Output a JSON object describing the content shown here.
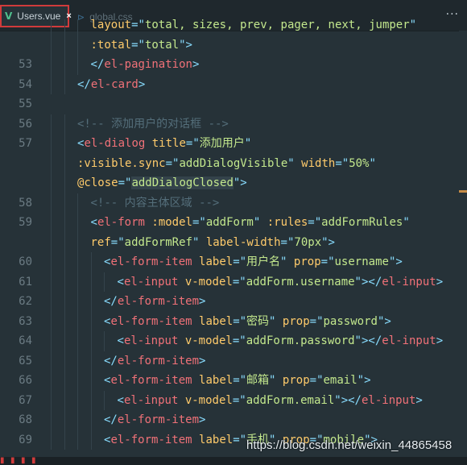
{
  "tabs": [
    {
      "name": "Users.vue",
      "icon": "vue-icon",
      "icon_glyph": "V",
      "close": "×",
      "active": true
    },
    {
      "name": "global.css",
      "icon": "css-icon",
      "icon_glyph": "⊳",
      "active": false
    }
  ],
  "tab_menu_label": "···",
  "colors": {
    "tag": "#f07178",
    "punctuation": "#89ddff",
    "attribute": "#ffcb6b",
    "string": "#c3e88d",
    "comment": "#546e7a",
    "background": "#263238",
    "active_tab_border": "#d03b3b"
  },
  "lines": [
    {
      "num": "",
      "indent": 3,
      "tokens": [
        [
          "a",
          "layout"
        ],
        [
          "p",
          "=\""
        ],
        [
          "s",
          "total, sizes, prev, pager, next, jumper"
        ],
        [
          "p",
          "\""
        ]
      ]
    },
    {
      "num": "",
      "indent": 3,
      "tokens": [
        [
          "a",
          ":total"
        ],
        [
          "p",
          "=\""
        ],
        [
          "s",
          "total"
        ],
        [
          "p",
          "\">"
        ]
      ]
    },
    {
      "num": "53",
      "indent": 3,
      "tokens": [
        [
          "p",
          "</"
        ],
        [
          "t",
          "el-pagination"
        ],
        [
          "p",
          ">"
        ]
      ]
    },
    {
      "num": "54",
      "indent": 2,
      "tokens": [
        [
          "p",
          "</"
        ],
        [
          "t",
          "el-card"
        ],
        [
          "p",
          ">"
        ]
      ]
    },
    {
      "num": "55",
      "indent": 0,
      "tokens": []
    },
    {
      "num": "56",
      "indent": 2,
      "tokens": [
        [
          "c",
          "<!-- 添加用户的对话框 -->"
        ]
      ]
    },
    {
      "num": "57",
      "indent": 2,
      "tokens": [
        [
          "p",
          "<"
        ],
        [
          "t",
          "el-dialog"
        ],
        [
          "w",
          " "
        ],
        [
          "a",
          "title"
        ],
        [
          "p",
          "=\""
        ],
        [
          "s",
          "添加用户"
        ],
        [
          "p",
          "\""
        ]
      ]
    },
    {
      "num": "",
      "indent": 2,
      "tokens": [
        [
          "a",
          ":visible.sync"
        ],
        [
          "p",
          "=\""
        ],
        [
          "s",
          "addDialogVisible"
        ],
        [
          "p",
          "\""
        ],
        [
          "w",
          " "
        ],
        [
          "a",
          "width"
        ],
        [
          "p",
          "=\""
        ],
        [
          "s",
          "50%"
        ],
        [
          "p",
          "\""
        ]
      ]
    },
    {
      "num": "",
      "indent": 2,
      "tokens": [
        [
          "a",
          "@close"
        ],
        [
          "p",
          "=\""
        ],
        [
          "s",
          "addDialogClosed"
        ],
        [
          "p",
          "\">"
        ]
      ]
    },
    {
      "num": "58",
      "indent": 3,
      "tokens": [
        [
          "c",
          "<!-- 内容主体区域 -->"
        ]
      ]
    },
    {
      "num": "59",
      "indent": 3,
      "tokens": [
        [
          "p",
          "<"
        ],
        [
          "t",
          "el-form"
        ],
        [
          "w",
          " "
        ],
        [
          "a",
          ":model"
        ],
        [
          "p",
          "=\""
        ],
        [
          "s",
          "addForm"
        ],
        [
          "p",
          "\""
        ],
        [
          "w",
          " "
        ],
        [
          "a",
          ":rules"
        ],
        [
          "p",
          "=\""
        ],
        [
          "s",
          "addFormRules"
        ],
        [
          "p",
          "\""
        ]
      ]
    },
    {
      "num": "",
      "indent": 3,
      "tokens": [
        [
          "a",
          "ref"
        ],
        [
          "p",
          "=\""
        ],
        [
          "s",
          "addFormRef"
        ],
        [
          "p",
          "\""
        ],
        [
          "w",
          " "
        ],
        [
          "a",
          "label-width"
        ],
        [
          "p",
          "=\""
        ],
        [
          "s",
          "70px"
        ],
        [
          "p",
          "\">"
        ]
      ]
    },
    {
      "num": "60",
      "indent": 4,
      "tokens": [
        [
          "p",
          "<"
        ],
        [
          "t",
          "el-form-item"
        ],
        [
          "w",
          " "
        ],
        [
          "a",
          "label"
        ],
        [
          "p",
          "=\""
        ],
        [
          "s",
          "用户名"
        ],
        [
          "p",
          "\""
        ],
        [
          "w",
          " "
        ],
        [
          "a",
          "prop"
        ],
        [
          "p",
          "=\""
        ],
        [
          "s",
          "username"
        ],
        [
          "p",
          "\">"
        ]
      ]
    },
    {
      "num": "61",
      "indent": 5,
      "tokens": [
        [
          "p",
          "<"
        ],
        [
          "t",
          "el-input"
        ],
        [
          "w",
          " "
        ],
        [
          "a",
          "v-model"
        ],
        [
          "p",
          "=\""
        ],
        [
          "s",
          "addForm.username"
        ],
        [
          "p",
          "\"></"
        ],
        [
          "t",
          "el-input"
        ],
        [
          "p",
          ">"
        ]
      ]
    },
    {
      "num": "62",
      "indent": 4,
      "tokens": [
        [
          "p",
          "</"
        ],
        [
          "t",
          "el-form-item"
        ],
        [
          "p",
          ">"
        ]
      ]
    },
    {
      "num": "63",
      "indent": 4,
      "tokens": [
        [
          "p",
          "<"
        ],
        [
          "t",
          "el-form-item"
        ],
        [
          "w",
          " "
        ],
        [
          "a",
          "label"
        ],
        [
          "p",
          "=\""
        ],
        [
          "s",
          "密码"
        ],
        [
          "p",
          "\""
        ],
        [
          "w",
          " "
        ],
        [
          "a",
          "prop"
        ],
        [
          "p",
          "=\""
        ],
        [
          "s",
          "password"
        ],
        [
          "p",
          "\">"
        ]
      ]
    },
    {
      "num": "64",
      "indent": 5,
      "tokens": [
        [
          "p",
          "<"
        ],
        [
          "t",
          "el-input"
        ],
        [
          "w",
          " "
        ],
        [
          "a",
          "v-model"
        ],
        [
          "p",
          "=\""
        ],
        [
          "s",
          "addForm.password"
        ],
        [
          "p",
          "\"></"
        ],
        [
          "t",
          "el-input"
        ],
        [
          "p",
          ">"
        ]
      ]
    },
    {
      "num": "65",
      "indent": 4,
      "tokens": [
        [
          "p",
          "</"
        ],
        [
          "t",
          "el-form-item"
        ],
        [
          "p",
          ">"
        ]
      ]
    },
    {
      "num": "66",
      "indent": 4,
      "tokens": [
        [
          "p",
          "<"
        ],
        [
          "t",
          "el-form-item"
        ],
        [
          "w",
          " "
        ],
        [
          "a",
          "label"
        ],
        [
          "p",
          "=\""
        ],
        [
          "s",
          "邮箱"
        ],
        [
          "p",
          "\""
        ],
        [
          "w",
          " "
        ],
        [
          "a",
          "prop"
        ],
        [
          "p",
          "=\""
        ],
        [
          "s",
          "email"
        ],
        [
          "p",
          "\">"
        ]
      ]
    },
    {
      "num": "67",
      "indent": 5,
      "tokens": [
        [
          "p",
          "<"
        ],
        [
          "t",
          "el-input"
        ],
        [
          "w",
          " "
        ],
        [
          "a",
          "v-model"
        ],
        [
          "p",
          "=\""
        ],
        [
          "s",
          "addForm.email"
        ],
        [
          "p",
          "\"></"
        ],
        [
          "t",
          "el-input"
        ],
        [
          "p",
          ">"
        ]
      ]
    },
    {
      "num": "68",
      "indent": 4,
      "tokens": [
        [
          "p",
          "</"
        ],
        [
          "t",
          "el-form-item"
        ],
        [
          "p",
          ">"
        ]
      ]
    },
    {
      "num": "69",
      "indent": 4,
      "tokens": [
        [
          "p",
          "<"
        ],
        [
          "t",
          "el-form-item"
        ],
        [
          "w",
          " "
        ],
        [
          "a",
          "label"
        ],
        [
          "p",
          "=\""
        ],
        [
          "s",
          "手机"
        ],
        [
          "p",
          "\""
        ],
        [
          "w",
          " "
        ],
        [
          "a",
          "prop"
        ],
        [
          "p",
          "=\""
        ],
        [
          "s",
          "mobile"
        ],
        [
          "p",
          "\">"
        ]
      ]
    }
  ],
  "highlighted_token": "addDialogClosed",
  "watermark": "https://blog.csdn.net/weixin_44865458"
}
